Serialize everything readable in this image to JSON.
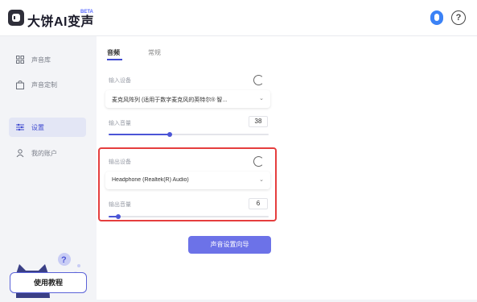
{
  "app": {
    "title": "大饼AI变声",
    "badge": "BETA"
  },
  "header": {
    "avatar_icon": "user-avatar-icon",
    "help_icon": "help-icon",
    "help_symbol": "?"
  },
  "sidebar": {
    "items": [
      {
        "label": "声音库",
        "icon": "grid-icon",
        "active": false
      },
      {
        "label": "声音定制",
        "icon": "bag-icon",
        "active": false
      },
      {
        "label": "设置",
        "icon": "settings-sliders-icon",
        "active": true
      },
      {
        "label": "我的账户",
        "icon": "user-icon",
        "active": false
      }
    ],
    "tutorial_label": "使用教程"
  },
  "tabs": [
    {
      "label": "音频",
      "active": true
    },
    {
      "label": "常规",
      "active": false
    }
  ],
  "input": {
    "device_label": "输入设备",
    "device_value": "麦克风阵列 (适用于数字麦克风的英特尔® 智...",
    "volume_label": "输入音量",
    "volume_value": "38",
    "volume_fraction": 0.38
  },
  "output": {
    "device_label": "输出设备",
    "device_value": "Headphone (Realtek(R) Audio)",
    "volume_label": "输出音量",
    "volume_value": "6",
    "volume_fraction": 0.06
  },
  "action_button": "声音设置向导",
  "colors": {
    "accent": "#4b55d6",
    "highlight": "#e53e3e",
    "button": "#6c72e8"
  }
}
